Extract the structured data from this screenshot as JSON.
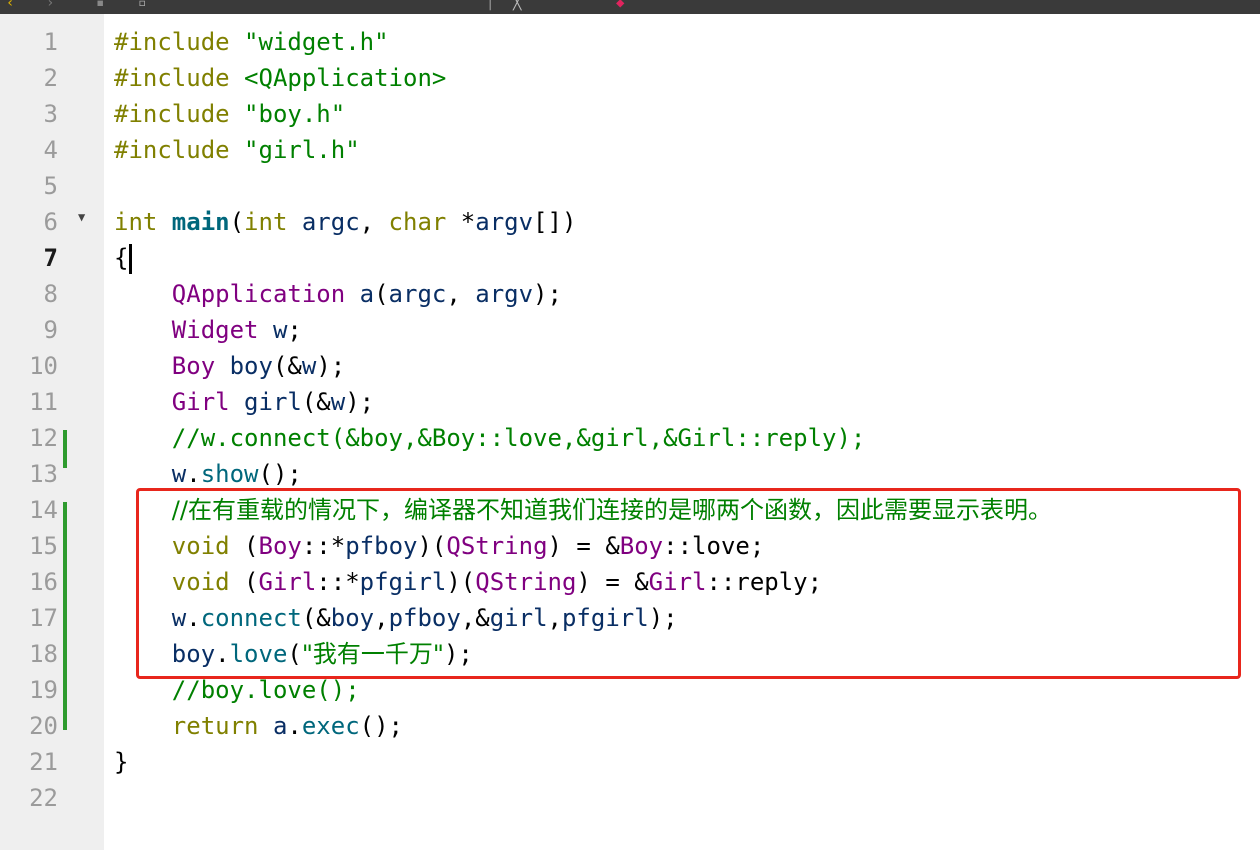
{
  "editor": {
    "current_line": 7,
    "line_numbers": [
      "1",
      "2",
      "3",
      "4",
      "5",
      "6",
      "7",
      "8",
      "9",
      "10",
      "11",
      "12",
      "13",
      "14",
      "15",
      "16",
      "17",
      "18",
      "19",
      "20",
      "21",
      "22"
    ],
    "lines": [
      [
        {
          "t": "#include ",
          "c": "kw"
        },
        {
          "t": "\"widget.h\"",
          "c": "str"
        }
      ],
      [
        {
          "t": "#include ",
          "c": "kw"
        },
        {
          "t": "<QApplication>",
          "c": "str"
        }
      ],
      [
        {
          "t": "#include ",
          "c": "kw"
        },
        {
          "t": "\"boy.h\"",
          "c": "str"
        }
      ],
      [
        {
          "t": "#include ",
          "c": "kw"
        },
        {
          "t": "\"girl.h\"",
          "c": "str"
        }
      ],
      [],
      [
        {
          "t": "int ",
          "c": "kw"
        },
        {
          "t": "main",
          "c": "fn"
        },
        {
          "t": "(",
          "c": "p"
        },
        {
          "t": "int ",
          "c": "kw"
        },
        {
          "t": "argc",
          "c": "var"
        },
        {
          "t": ", ",
          "c": "p"
        },
        {
          "t": "char ",
          "c": "kw"
        },
        {
          "t": "*",
          "c": "p"
        },
        {
          "t": "argv",
          "c": "var"
        },
        {
          "t": "[])",
          "c": "p"
        }
      ],
      [
        {
          "t": "{",
          "c": "p"
        }
      ],
      [
        {
          "t": "    ",
          "c": "p"
        },
        {
          "t": "QApplication",
          "c": "typ"
        },
        {
          "t": " a",
          "c": "var"
        },
        {
          "t": "(",
          "c": "p"
        },
        {
          "t": "argc",
          "c": "var"
        },
        {
          "t": ", ",
          "c": "p"
        },
        {
          "t": "argv",
          "c": "var"
        },
        {
          "t": ");",
          "c": "p"
        }
      ],
      [
        {
          "t": "    ",
          "c": "p"
        },
        {
          "t": "Widget",
          "c": "typ"
        },
        {
          "t": " w",
          "c": "var"
        },
        {
          "t": ";",
          "c": "p"
        }
      ],
      [
        {
          "t": "    ",
          "c": "p"
        },
        {
          "t": "Boy",
          "c": "typ"
        },
        {
          "t": " boy",
          "c": "var"
        },
        {
          "t": "(&",
          "c": "p"
        },
        {
          "t": "w",
          "c": "var"
        },
        {
          "t": ");",
          "c": "p"
        }
      ],
      [
        {
          "t": "    ",
          "c": "p"
        },
        {
          "t": "Girl",
          "c": "typ"
        },
        {
          "t": " girl",
          "c": "var"
        },
        {
          "t": "(&",
          "c": "p"
        },
        {
          "t": "w",
          "c": "var"
        },
        {
          "t": ");",
          "c": "p"
        }
      ],
      [
        {
          "t": "    ",
          "c": "p"
        },
        {
          "t": "//w.connect(&boy,&Boy::love,&girl,&Girl::reply);",
          "c": "cmt"
        }
      ],
      [
        {
          "t": "    ",
          "c": "p"
        },
        {
          "t": "w",
          "c": "var"
        },
        {
          "t": ".",
          "c": "p"
        },
        {
          "t": "show",
          "c": "mem"
        },
        {
          "t": "();",
          "c": "p"
        }
      ],
      [
        {
          "t": "    ",
          "c": "p"
        },
        {
          "t": "//在有重载的情况下，编译器不知道我们连接的是哪两个函数，因此需要显示表明。",
          "c": "cmt zh"
        }
      ],
      [
        {
          "t": "    ",
          "c": "p"
        },
        {
          "t": "void ",
          "c": "kw"
        },
        {
          "t": "(",
          "c": "p"
        },
        {
          "t": "Boy",
          "c": "typ"
        },
        {
          "t": "::*",
          "c": "p"
        },
        {
          "t": "pfboy",
          "c": "var"
        },
        {
          "t": ")(",
          "c": "p"
        },
        {
          "t": "QString",
          "c": "typ"
        },
        {
          "t": ") = &",
          "c": "p"
        },
        {
          "t": "Boy",
          "c": "typ"
        },
        {
          "t": "::love;",
          "c": "p"
        }
      ],
      [
        {
          "t": "    ",
          "c": "p"
        },
        {
          "t": "void ",
          "c": "kw"
        },
        {
          "t": "(",
          "c": "p"
        },
        {
          "t": "Girl",
          "c": "typ"
        },
        {
          "t": "::*",
          "c": "p"
        },
        {
          "t": "pfgirl",
          "c": "var"
        },
        {
          "t": ")(",
          "c": "p"
        },
        {
          "t": "QString",
          "c": "typ"
        },
        {
          "t": ") = &",
          "c": "p"
        },
        {
          "t": "Girl",
          "c": "typ"
        },
        {
          "t": "::reply;",
          "c": "p"
        }
      ],
      [
        {
          "t": "    ",
          "c": "p"
        },
        {
          "t": "w",
          "c": "var"
        },
        {
          "t": ".",
          "c": "p"
        },
        {
          "t": "connect",
          "c": "mem"
        },
        {
          "t": "(&",
          "c": "p"
        },
        {
          "t": "boy",
          "c": "var"
        },
        {
          "t": ",",
          "c": "p"
        },
        {
          "t": "pfboy",
          "c": "var"
        },
        {
          "t": ",&",
          "c": "p"
        },
        {
          "t": "girl",
          "c": "var"
        },
        {
          "t": ",",
          "c": "p"
        },
        {
          "t": "pfgirl",
          "c": "var"
        },
        {
          "t": ");",
          "c": "p"
        }
      ],
      [
        {
          "t": "    ",
          "c": "p"
        },
        {
          "t": "boy",
          "c": "var"
        },
        {
          "t": ".",
          "c": "p"
        },
        {
          "t": "love",
          "c": "mem"
        },
        {
          "t": "(",
          "c": "p"
        },
        {
          "t": "\"我有一千万\"",
          "c": "str zh"
        },
        {
          "t": ");",
          "c": "p"
        }
      ],
      [
        {
          "t": "    ",
          "c": "p"
        },
        {
          "t": "//boy.love();",
          "c": "cmt"
        }
      ],
      [
        {
          "t": "    ",
          "c": "p"
        },
        {
          "t": "return ",
          "c": "kw"
        },
        {
          "t": "a",
          "c": "var"
        },
        {
          "t": ".",
          "c": "p"
        },
        {
          "t": "exec",
          "c": "mem"
        },
        {
          "t": "();",
          "c": "p"
        }
      ],
      [
        {
          "t": "}",
          "c": "p"
        }
      ],
      []
    ]
  },
  "colors": {
    "keyword": "#808000",
    "string": "#008000",
    "type": "#800080",
    "comment": "#008000",
    "function": "#00677c",
    "change_marker": "#2e9b2e",
    "highlight_box": "#e8261c"
  },
  "icons": {
    "fold_arrow": "fold-arrow-icon",
    "text_cursor": "text-cursor-icon"
  }
}
